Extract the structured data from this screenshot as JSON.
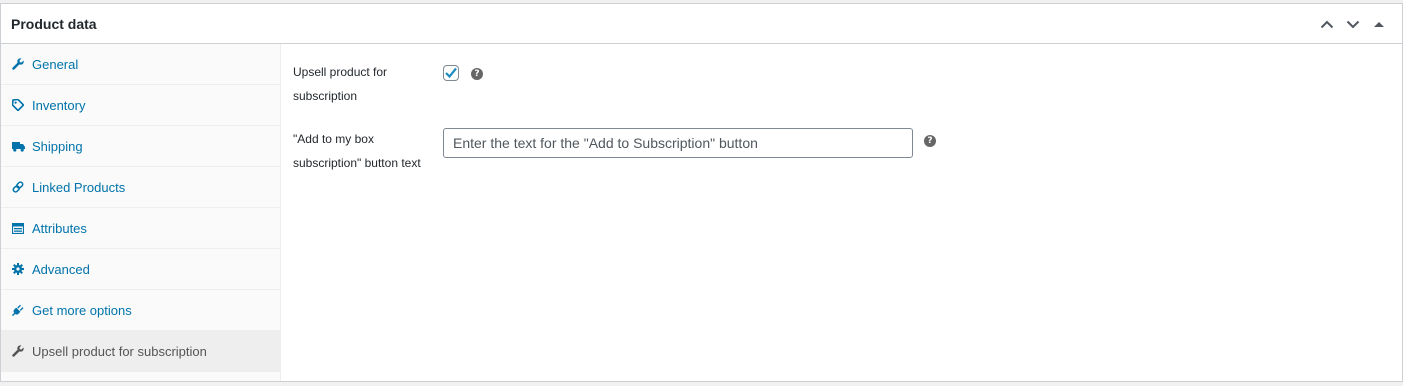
{
  "panel": {
    "title": "Product data"
  },
  "header_controls": [
    {
      "name": "move-up-button",
      "icon": "chevron-up-icon"
    },
    {
      "name": "move-down-button",
      "icon": "chevron-down-icon"
    },
    {
      "name": "toggle-panel-button",
      "icon": "triangle-up-icon"
    }
  ],
  "tabs": [
    {
      "label": "General",
      "icon": "wrench-icon"
    },
    {
      "label": "Inventory",
      "icon": "tag-icon"
    },
    {
      "label": "Shipping",
      "icon": "truck-icon"
    },
    {
      "label": "Linked Products",
      "icon": "link-icon"
    },
    {
      "label": "Attributes",
      "icon": "list-icon"
    },
    {
      "label": "Advanced",
      "icon": "gear-icon"
    },
    {
      "label": "Get more options",
      "icon": "plug-icon"
    },
    {
      "label": "Upsell product for subscription",
      "icon": "wrench-icon",
      "active": true
    }
  ],
  "fields": {
    "upsell": {
      "label_line1": "Upsell product for",
      "label_line2": "subscription",
      "checked": true,
      "help": "?"
    },
    "button_text": {
      "label_line1": "\"Add to my box",
      "label_line2": "subscription\" button text",
      "value": "",
      "placeholder": "Enter the text for the \"Add to Subscription\" button",
      "help": "?"
    }
  },
  "colors": {
    "link": "#0073aa",
    "checkmark": "#1e8cbe",
    "border": "#ccd0d4"
  }
}
